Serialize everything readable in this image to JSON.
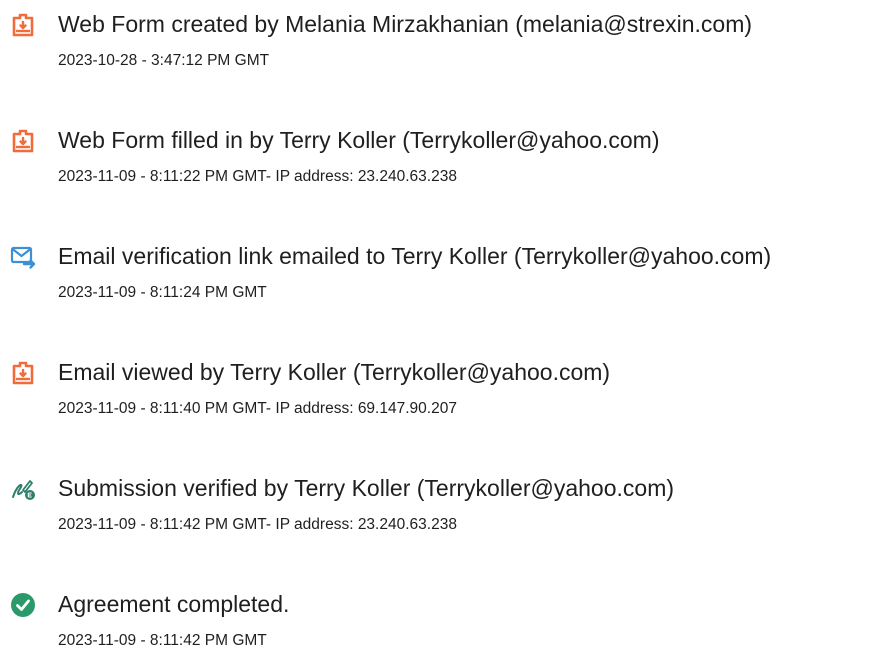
{
  "icons": {
    "document": "document-icon",
    "email": "email-icon",
    "signature": "signature-icon",
    "check": "check-circle-icon"
  },
  "colors": {
    "document_icon": "#f26b3a",
    "email_icon": "#3d8fd6",
    "signature_icon": "#2e7d6b",
    "check_icon": "#2a9a6b"
  },
  "events": [
    {
      "title": "Web Form created by Melania Mirzakhanian (melania@strexin.com)",
      "meta": "2023-10-28 - 3:47:12 PM GMT"
    },
    {
      "title": "Web Form filled in by Terry Koller (Terrykoller@yahoo.com)",
      "meta": "2023-11-09 - 8:11:22 PM GMT- IP address: 23.240.63.238"
    },
    {
      "title": "Email verification link emailed to Terry Koller (Terrykoller@yahoo.com)",
      "meta": "2023-11-09 - 8:11:24 PM GMT"
    },
    {
      "title": "Email viewed by Terry Koller (Terrykoller@yahoo.com)",
      "meta": "2023-11-09 - 8:11:40 PM GMT- IP address: 69.147.90.207"
    },
    {
      "title": "Submission verified by Terry Koller (Terrykoller@yahoo.com)",
      "meta": "2023-11-09 - 8:11:42 PM GMT- IP address: 23.240.63.238"
    },
    {
      "title": "Agreement completed.",
      "meta": "2023-11-09 - 8:11:42 PM GMT"
    }
  ]
}
